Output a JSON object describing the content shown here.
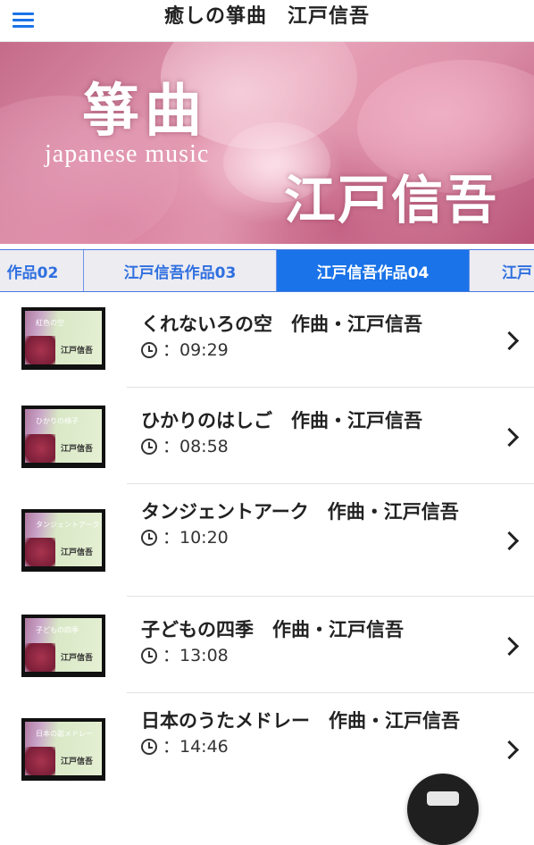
{
  "header": {
    "title": "癒しの箏曲　江戸信吾",
    "menu_icon": "hamburger-menu-icon"
  },
  "banner": {
    "koto_text": "箏曲",
    "subtitle": "japanese music",
    "name_text": "江戸信吾"
  },
  "tabs": [
    {
      "label": "作品02"
    },
    {
      "label": "江戸信吾作品03"
    },
    {
      "label": "江戸信吾作品04",
      "active": true
    },
    {
      "label": "江戸"
    }
  ],
  "colors": {
    "accent": "#1a73e8",
    "tab_bg": "#ececf1"
  },
  "songs": [
    {
      "title": "くれないろの空　作曲・江戸信吾",
      "duration": "：09:29",
      "thumb_text": "紅色の空",
      "thumb_mark": "江戸信吾"
    },
    {
      "title": "ひかりのはしご　作曲・江戸信吾",
      "duration": "：08:58",
      "thumb_text": "ひかりの梯子",
      "thumb_mark": "江戸信吾"
    },
    {
      "title": "タンジェントアーク　作曲・江戸信吾",
      "duration": "：10:20",
      "thumb_text": "タンジェントアーク",
      "thumb_mark": "江戸信吾"
    },
    {
      "title": "子どもの四季　作曲・江戸信吾",
      "duration": "：13:08",
      "thumb_text": "子どもの四季",
      "thumb_mark": "江戸信吾"
    },
    {
      "title": "日本のうたメドレー　作曲・江戸信吾",
      "duration": "：14:46",
      "thumb_text": "日本の歌メドレー",
      "thumb_mark": "江戸信吾"
    }
  ]
}
